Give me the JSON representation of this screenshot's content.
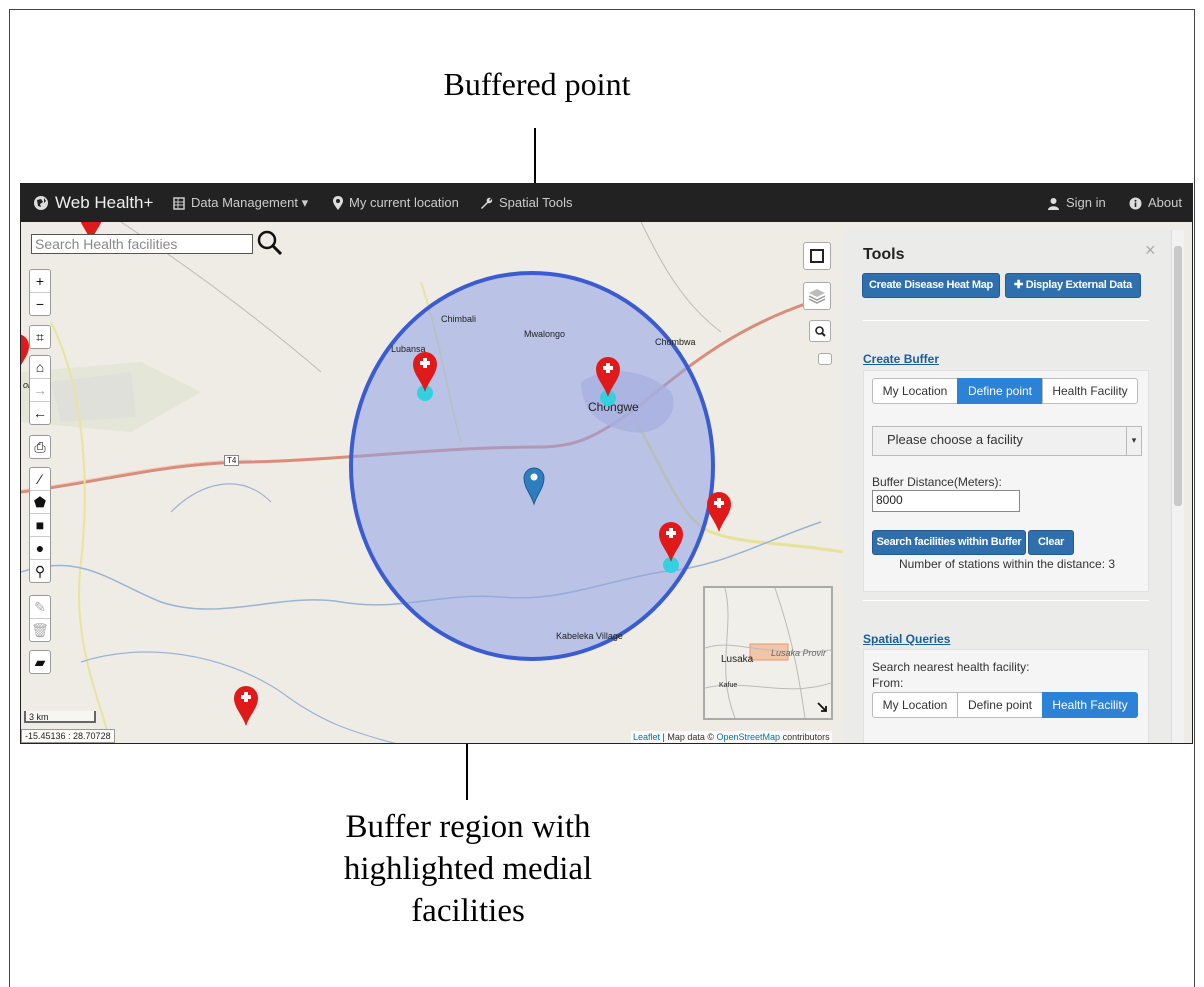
{
  "annotations": {
    "top_caption": "Buffered point",
    "bottom_caption_lines": [
      "Buffer region with",
      "highlighted medial",
      "facilities"
    ]
  },
  "navbar": {
    "brand": "Web Health+",
    "items": [
      {
        "label": "Data Management ▾",
        "icon": "table-icon"
      },
      {
        "label": "My current location",
        "icon": "map-marker-icon"
      },
      {
        "label": "Spatial Tools",
        "icon": "wrench-icon"
      }
    ],
    "right_items": [
      {
        "label": "Sign in",
        "icon": "user-icon"
      },
      {
        "label": "About",
        "icon": "info-icon"
      }
    ]
  },
  "map": {
    "search_placeholder": "Search Health facilities",
    "places": {
      "chimbali": "Chimbali",
      "mwalongo": "Mwalongo",
      "chombwa": "Chombwa",
      "lubansa": "Lubansa",
      "chongwe": "Chongwe",
      "kabeleka": "Kabeleka Village",
      "t4": "T4",
      "left_cut": "onal"
    },
    "scale_label": "3 km",
    "coords": "-15.45136 : 28.70728",
    "attribution": {
      "leaflet": "Leaflet",
      "sep": " | Map data © ",
      "osm": "OpenStreetMap",
      "tail": " contributors"
    },
    "minimap": {
      "lusaka": "Lusaka",
      "province": "Lusaka Provir",
      "kafue": "Kafue"
    },
    "colors": {
      "buffer_fill": "#8fa2e8",
      "buffer_stroke": "#3b5bd1",
      "marker_red": "#e01a1a",
      "point_blue": "#2e7dbe",
      "highlight": "#33d1e0"
    }
  },
  "panel": {
    "title": "Tools",
    "heatmap_button": "Create Disease Heat Map",
    "external_button": "Display External Data",
    "create_buffer": {
      "heading": "Create Buffer",
      "segments": [
        "My Location",
        "Define point",
        "Health Facility"
      ],
      "active_segment": "Define point",
      "select_value": "Please choose a facility",
      "distance_label": "Buffer Distance(Meters):",
      "distance_value": "8000",
      "search_button": "Search facilities within Buffer",
      "clear_button": "Clear",
      "result_text": "Number of stations within the distance: 3"
    },
    "spatial_queries": {
      "heading": "Spatial Queries",
      "prompt": "Search nearest health facility:",
      "from_label": "From:",
      "segments": [
        "My Location",
        "Define point",
        "Health Facility"
      ],
      "active_segment": "Health Facility"
    }
  }
}
